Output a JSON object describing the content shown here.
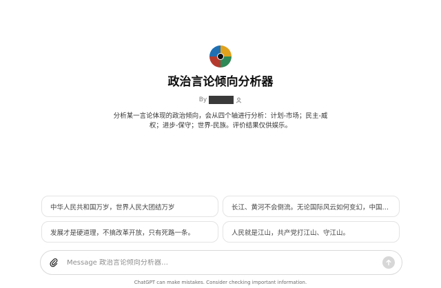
{
  "gpt": {
    "title": "政治言论倾向分析器",
    "by_prefix": "By",
    "description": "分析某一言论体现的政治倾向，会从四个轴进行分析：计划-市场；民主-威权；进步-保守；世界-民族。评价结果仅供娱乐。"
  },
  "starters": [
    {
      "text": "中华人民共和国万岁，世界人民大团结万岁"
    },
    {
      "text": "长江、黄河不会倒流。无论国际风云如何变幻，中国…"
    },
    {
      "text": "发展才是硬道理，不搞改革开放，只有死路一条。"
    },
    {
      "text": "人民就是江山，共产党打江山、守江山。"
    }
  ],
  "composer": {
    "placeholder": "Message 政治言论倾向分析器…",
    "value": ""
  },
  "footer": {
    "disclaimer": "ChatGPT can make mistakes. Consider checking important information."
  },
  "icons": {
    "gpt_avatar": "gpt-avatar-icon",
    "author": "person-icon",
    "attach": "paperclip-icon",
    "send": "arrow-up-icon"
  }
}
